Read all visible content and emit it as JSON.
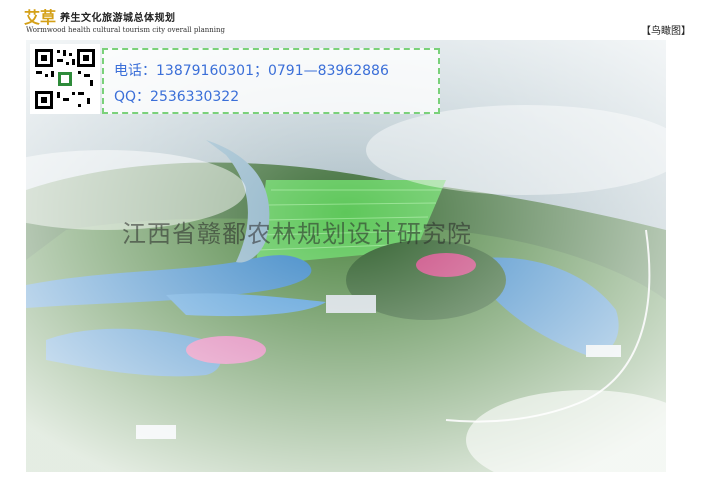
{
  "header": {
    "logo_text": "艾草",
    "title_cn": "养生文化旅游城总体规划",
    "title_en": "Wormwood health cultural tourism city overall planning",
    "view_label": "【鸟瞰图】"
  },
  "contact": {
    "phone": "电话：13879160301；0791—83962886",
    "qq": "QQ：2536330322"
  },
  "watermark": "江西省赣鄱农林规划设计研究院",
  "qr_icon": "qr-code-icon"
}
